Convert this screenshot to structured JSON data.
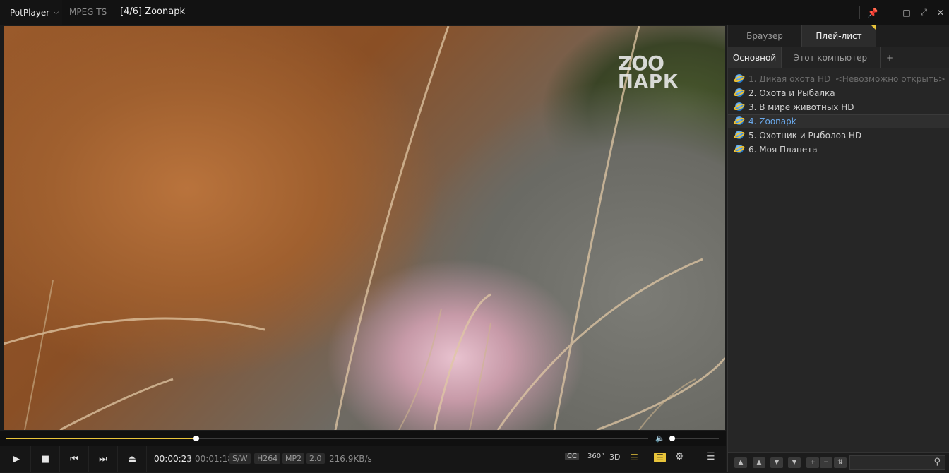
{
  "titlebar": {
    "app_name": "PotPlayer",
    "format": "MPEG TS",
    "title": "[4/6] Zoonapk"
  },
  "video": {
    "watermark_line1": "ZOO",
    "watermark_line2": "ПАРК"
  },
  "seek": {
    "progress_fraction": 0.2967
  },
  "volume": {
    "level_fraction": 0.0
  },
  "controls": {
    "time_current": "00:00:23",
    "time_separator": "/",
    "time_total": "00:01:18",
    "badges": [
      "S/W",
      "H264",
      "MP2",
      "2.0"
    ],
    "bitrate": "216.9KB/s",
    "right_icons": [
      "CC",
      "360°",
      "3D"
    ]
  },
  "panel": {
    "tabs": [
      "Браузер",
      "Плей-лист"
    ],
    "subtabs": [
      "Основной",
      "Этот компьютер",
      "+"
    ],
    "items": [
      {
        "label": "1. Дикая охота HD",
        "note": "<Невозможно открыть>"
      },
      {
        "label": "2. Охота и Рыбалка"
      },
      {
        "label": "3. В мире животных HD"
      },
      {
        "label": "4. Zoonapk"
      },
      {
        "label": "5. Охотник и Рыболов HD"
      },
      {
        "label": "6. Моя Планета"
      }
    ]
  },
  "colors": {
    "accent": "#e8c43a",
    "current_item": "#6aa8ea"
  }
}
